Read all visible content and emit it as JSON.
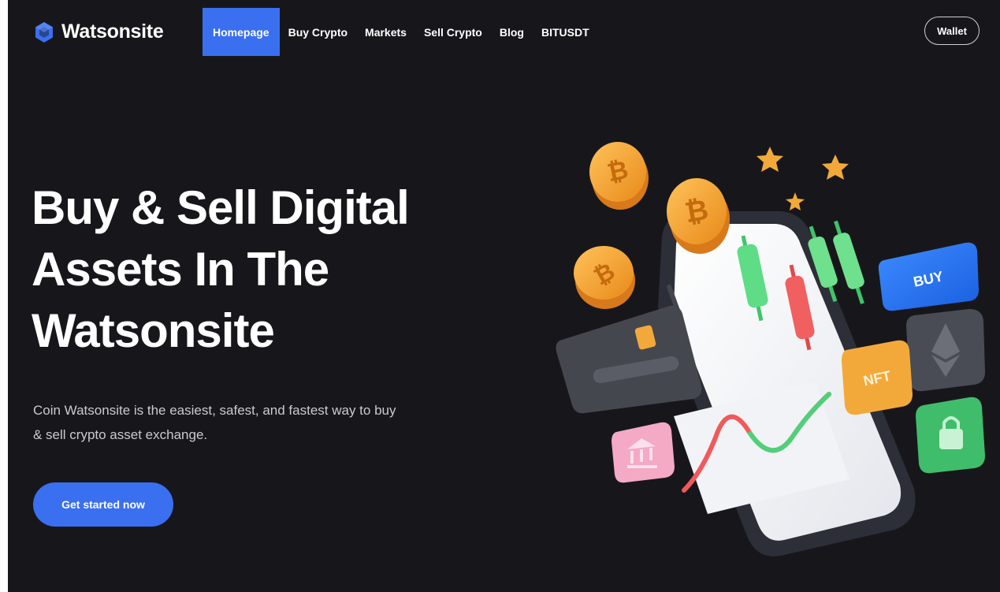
{
  "brand": {
    "name": "Watsonsite",
    "accent": "#3a6ff0",
    "background": "#17171b"
  },
  "nav": {
    "items": [
      {
        "label": "Homepage",
        "active": true
      },
      {
        "label": "Buy Crypto",
        "active": false
      },
      {
        "label": "Markets",
        "active": false
      },
      {
        "label": "Sell Crypto",
        "active": false
      },
      {
        "label": "Blog",
        "active": false
      },
      {
        "label": "BITUSDT",
        "active": false
      }
    ],
    "wallet_label": "Wallet"
  },
  "hero": {
    "title_lines": [
      "Buy & Sell Digital",
      "Assets In The",
      "Watsonsite"
    ],
    "subtitle_lines": [
      "Coin Watsonsite is the easiest, safest, and fastest way to buy",
      "& sell crypto asset exchange."
    ],
    "cta_label": "Get started now"
  },
  "illustration": {
    "buy_label": "BUY",
    "nft_label": "NFT",
    "icons": [
      "bitcoin-coin-icon",
      "star-icon",
      "ethereum-icon",
      "lock-icon",
      "bank-icon",
      "credit-card-icon",
      "smartphone-icon"
    ]
  }
}
